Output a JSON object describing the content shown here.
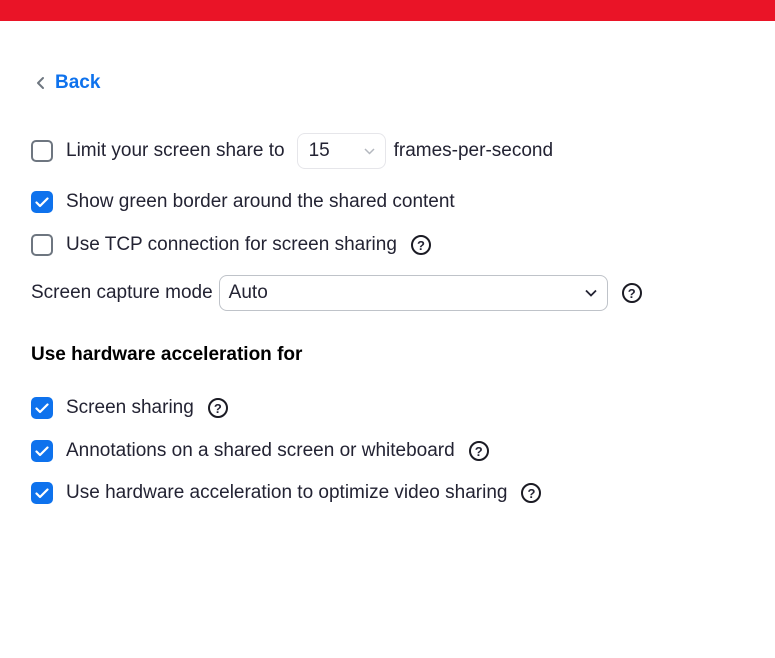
{
  "back": {
    "label": "Back"
  },
  "fps": {
    "label": "Limit your screen share to",
    "value": "15",
    "unit": "frames-per-second",
    "checked": false
  },
  "options": {
    "green_border": {
      "label": "Show green border around the shared content",
      "checked": true
    },
    "tcp": {
      "label": "Use TCP connection for screen sharing",
      "checked": false
    }
  },
  "capture_mode": {
    "label": "Screen capture mode",
    "value": "Auto"
  },
  "hw_accel": {
    "heading": "Use hardware acceleration for",
    "items": [
      {
        "label": "Screen sharing",
        "checked": true
      },
      {
        "label": "Annotations on a shared screen or whiteboard",
        "checked": true
      },
      {
        "label": "Use hardware acceleration to optimize video sharing",
        "checked": true
      }
    ]
  },
  "help_glyph": "?",
  "colors": {
    "accent": "#0e72ed",
    "topbar": "#ea1427"
  }
}
